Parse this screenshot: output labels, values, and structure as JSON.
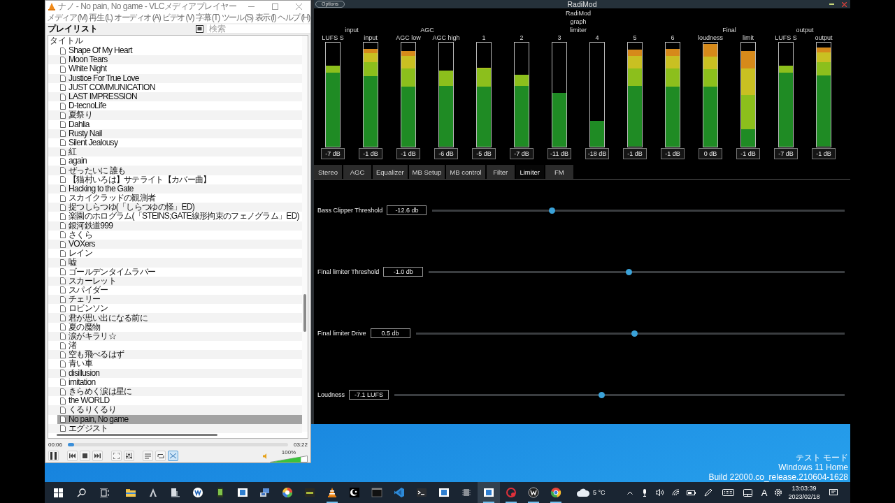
{
  "vlc": {
    "title": "ナノ - No pain, No game - VLCメディアプレイヤー",
    "menu": [
      "メディア (M)",
      "再生 (L)",
      "オーディオ (A)",
      "ビデオ (V)",
      "字幕 (T)",
      "ツール (S)",
      "表示 (I)",
      "ヘルプ (H)"
    ],
    "playlist_title": "プレイリスト",
    "search": {
      "placeholder": "検索"
    },
    "column": "タイトル",
    "items": [
      {
        "title": "Shape Of My Heart",
        "selected": false
      },
      {
        "title": "Moon Tears",
        "selected": false
      },
      {
        "title": "White Night",
        "selected": false
      },
      {
        "title": "Justice For True Love",
        "selected": false
      },
      {
        "title": "JUST COMMUNICATION",
        "selected": false
      },
      {
        "title": "LAST IMPRESSION",
        "selected": false
      },
      {
        "title": "D-tecnoLife",
        "selected": false
      },
      {
        "title": "夏祭り",
        "selected": false
      },
      {
        "title": "Dahlia",
        "selected": false
      },
      {
        "title": "Rusty Nail",
        "selected": false
      },
      {
        "title": "Silent Jealousy",
        "selected": false
      },
      {
        "title": "紅",
        "selected": false
      },
      {
        "title": "again",
        "selected": false
      },
      {
        "title": "ぜったいに 誰も",
        "selected": false
      },
      {
        "title": "【猫村いろは】サテライト【カバー曲】",
        "selected": false
      },
      {
        "title": "Hacking to the Gate",
        "selected": false
      },
      {
        "title": "スカイクラッドの観測者",
        "selected": false
      },
      {
        "title": "捉つしらつゆ(「しらつゆの怪」ED)",
        "selected": false
      },
      {
        "title": "楽園のホログラム(「STEINS;GATE線形拘束のフェノグラム」ED)",
        "selected": false
      },
      {
        "title": "銀河鉄道999",
        "selected": false
      },
      {
        "title": "さくら",
        "selected": false
      },
      {
        "title": "VOXers",
        "selected": false
      },
      {
        "title": "レイン",
        "selected": false
      },
      {
        "title": "嘘",
        "selected": false
      },
      {
        "title": "ゴールデンタイムラバー",
        "selected": false
      },
      {
        "title": "スカーレット",
        "selected": false
      },
      {
        "title": "スパイダー",
        "selected": false
      },
      {
        "title": "チェリー",
        "selected": false
      },
      {
        "title": "ロビンソン",
        "selected": false
      },
      {
        "title": "君が思い出になる前に",
        "selected": false
      },
      {
        "title": "夏の魔物",
        "selected": false
      },
      {
        "title": "涙がキラリ☆",
        "selected": false
      },
      {
        "title": "渚",
        "selected": false
      },
      {
        "title": "空も飛べるはず",
        "selected": false
      },
      {
        "title": "青い車",
        "selected": false
      },
      {
        "title": "disillusion",
        "selected": false
      },
      {
        "title": "imitation",
        "selected": false
      },
      {
        "title": "きらめく涙は星に",
        "selected": false
      },
      {
        "title": "the WORLD",
        "selected": false
      },
      {
        "title": "くるりくるり",
        "selected": false
      },
      {
        "title": "No pain, No game",
        "selected": true
      },
      {
        "title": "エグジスト",
        "selected": false
      }
    ],
    "elapsed": "00:06",
    "duration": "03:22",
    "progress": {
      "level": 0.03
    },
    "playing": true,
    "shuffle": {
      "on": true
    },
    "volume": {
      "level": 0.82,
      "reading": "100%"
    }
  },
  "radimod": {
    "title": "RadiMod",
    "options": "Options",
    "groups": [
      {
        "label": "input",
        "meters": [
          {
            "label": "LUFS S",
            "reading": "-7 dB",
            "kind": "lufs",
            "level": 0.78
          },
          {
            "label": "input",
            "reading": "-1 dB",
            "kind": "peak",
            "level": 0.94
          }
        ]
      },
      {
        "label": "AGC",
        "meters": [
          {
            "label": "AGC low",
            "reading": "-1 dB",
            "kind": "band",
            "level": 0.92
          },
          {
            "label": "AGC high",
            "reading": "-6 dB",
            "kind": "band",
            "level": 0.73
          }
        ]
      },
      {
        "meters": [
          {
            "label": "1",
            "reading": "-5 dB",
            "kind": "band",
            "level": 0.76
          },
          {
            "label": "2",
            "reading": "-7 dB",
            "kind": "band",
            "level": 0.69
          }
        ]
      },
      {
        "label": "RadiMod graph limiter",
        "meters": [
          {
            "label": "3",
            "reading": "-11 dB",
            "kind": "band",
            "level": 0.52
          },
          {
            "label": "4",
            "reading": "-18 dB",
            "kind": "band",
            "level": 0.25
          }
        ]
      },
      {
        "meters": [
          {
            "label": "5",
            "reading": "-1 dB",
            "kind": "band",
            "level": 0.93
          },
          {
            "label": "6",
            "reading": "-1 dB",
            "kind": "band",
            "level": 0.94
          }
        ]
      },
      {
        "label": "Final",
        "meters": [
          {
            "label": "loudness",
            "reading": "0 dB",
            "kind": "band",
            "level": 0.99
          },
          {
            "label": "limit",
            "reading": "-1 dB",
            "kind": "limit",
            "level": 0.92
          }
        ]
      },
      {
        "label": "output",
        "meters": [
          {
            "label": "LUFS S",
            "reading": "-7 dB",
            "kind": "lufs",
            "level": 0.78
          },
          {
            "label": "output",
            "reading": "-1 dB",
            "kind": "peak",
            "level": 0.95
          }
        ]
      }
    ],
    "tabs": [
      {
        "label": "Stereo",
        "selected": false
      },
      {
        "label": "AGC",
        "selected": false
      },
      {
        "label": "Equalizer",
        "selected": false
      },
      {
        "label": "MB Setup",
        "selected": false
      },
      {
        "label": "MB control",
        "selected": false
      },
      {
        "label": "Filter",
        "selected": false
      },
      {
        "label": "Limiter",
        "selected": true
      },
      {
        "label": "FM",
        "selected": false
      }
    ],
    "sliders": [
      {
        "label": "Bass Clipper Threshold",
        "value": "-12.6 db",
        "level": 0.29
      },
      {
        "label": "Final limiter Threshold",
        "value": "-1.0 db",
        "level": 0.48
      },
      {
        "label": "Final limiter Drive",
        "value": "0.5 db",
        "level": 0.51
      },
      {
        "label": "Loudness",
        "value": "-7.1 LUFS",
        "level": 0.46
      }
    ]
  },
  "desktop_notice": [
    "テスト モード",
    "Windows 11 Home",
    "Build 22000.co_release.210604-1628"
  ],
  "taskbar": {
    "apps": [
      {
        "running": false,
        "selected": false
      },
      {
        "running": false,
        "selected": false
      },
      {
        "running": false,
        "selected": false
      },
      {
        "running": false,
        "selected": false
      },
      {
        "running": false,
        "selected": false
      },
      {
        "running": false,
        "selected": false
      },
      {
        "running": false,
        "selected": false
      },
      {
        "running": false,
        "selected": false
      },
      {
        "running": false,
        "selected": false
      },
      {
        "running": true,
        "selected": false
      },
      {
        "running": false,
        "selected": false
      },
      {
        "running": false,
        "selected": false
      },
      {
        "running": false,
        "selected": false
      },
      {
        "running": false,
        "selected": false
      },
      {
        "running": false,
        "selected": false
      },
      {
        "running": false,
        "selected": false
      },
      {
        "running": true,
        "selected": true
      },
      {
        "running": true,
        "selected": false
      },
      {
        "running": true,
        "selected": false
      },
      {
        "running": true,
        "selected": false
      }
    ],
    "weather": "5 °C",
    "ime": "A",
    "time": "13:03:39",
    "date": "2023/02/18"
  }
}
